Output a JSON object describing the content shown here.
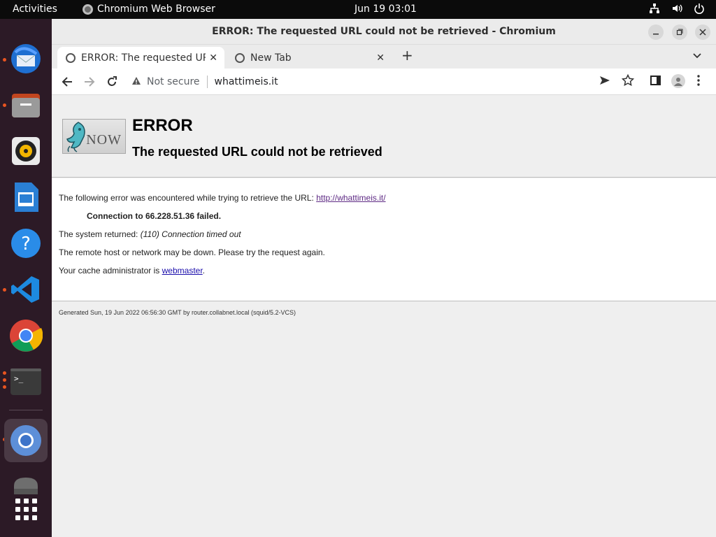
{
  "topbar": {
    "activities": "Activities",
    "app_name": "Chromium Web Browser",
    "clock": "Jun 19  03:01"
  },
  "dock": {
    "items": [
      {
        "name": "thunderbird-icon"
      },
      {
        "name": "files-icon"
      },
      {
        "name": "rhythmbox-icon"
      },
      {
        "name": "writer-icon"
      },
      {
        "name": "help-icon"
      },
      {
        "name": "vscode-icon"
      },
      {
        "name": "chrome-icon"
      },
      {
        "name": "terminal-icon"
      },
      {
        "name": "chromium-icon"
      },
      {
        "name": "disk-icon"
      },
      {
        "name": "app-grid-icon"
      }
    ]
  },
  "window": {
    "title": "ERROR: The requested URL could not be retrieved - Chromium"
  },
  "tabs": [
    {
      "label": "ERROR: The requested UR"
    },
    {
      "label": "New Tab"
    }
  ],
  "toolbar": {
    "security": "Not secure",
    "url": "whattimeis.it"
  },
  "page": {
    "logo_text": "NOW",
    "h1": "ERROR",
    "h2": "The requested URL could not be retrieved",
    "line1_prefix": "The following error was encountered while trying to retrieve the URL: ",
    "line1_link": "http://whattimeis.it/",
    "line2": "Connection to 66.228.51.36 failed.",
    "line3_prefix": "The system returned: ",
    "line3_em": "(110) Connection timed out",
    "line4": "The remote host or network may be down. Please try the request again.",
    "line5_prefix": "Your cache administrator is ",
    "line5_link": "webmaster",
    "line5_suffix": ".",
    "footer": "Generated Sun, 19 Jun 2022 06:56:30 GMT by router.collabnet.local (squid/5.2-VCS)"
  },
  "colors": {
    "dock_bg": "#2c1a26",
    "ubuntu_orange": "#e95420",
    "link_visited": "#5e2a84",
    "link": "#1a0dab"
  }
}
